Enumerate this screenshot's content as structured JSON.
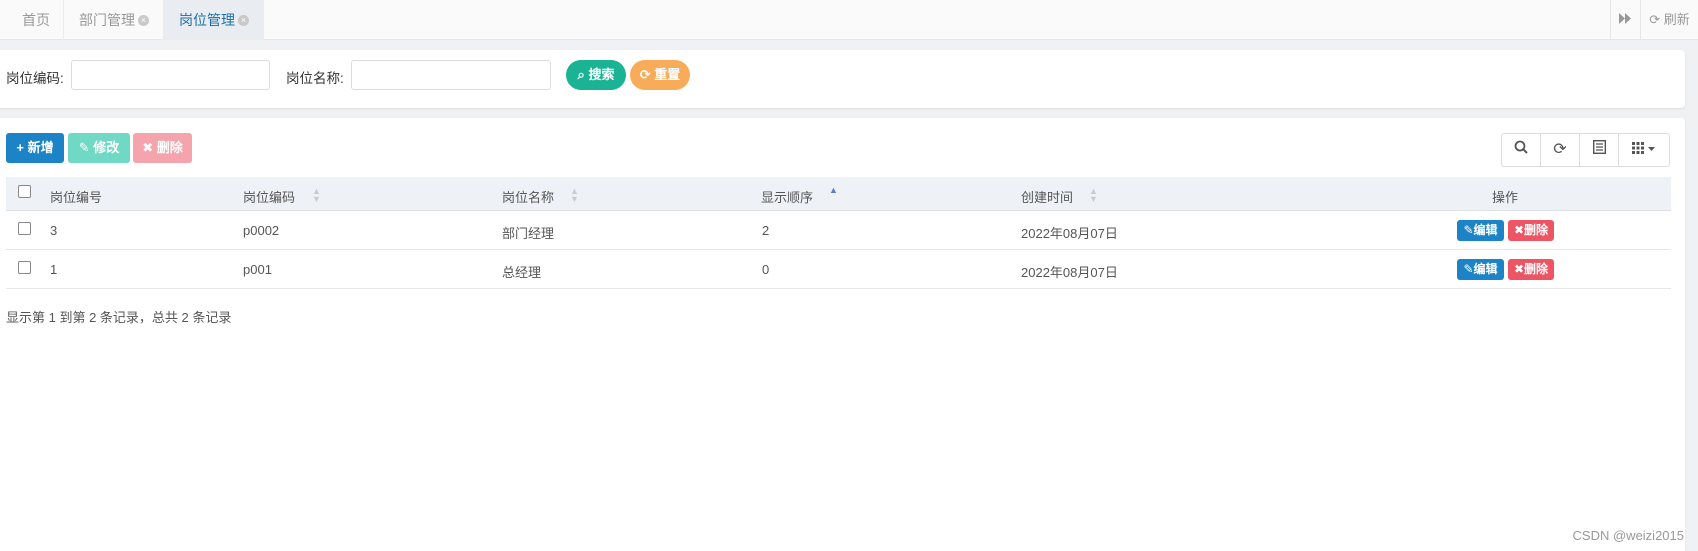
{
  "tabs": [
    {
      "label": "首页",
      "closable": false,
      "active": false
    },
    {
      "label": "部门管理",
      "closable": true,
      "active": false
    },
    {
      "label": "岗位管理",
      "closable": true,
      "active": true
    }
  ],
  "tabbar_right": {
    "forward_icon": "double-chevron-right-icon",
    "refresh_label": "刷新"
  },
  "search": {
    "post_code_label": "岗位编码:",
    "post_code_value": "",
    "post_name_label": "岗位名称:",
    "post_name_value": "",
    "search_button": "搜索",
    "reset_button": "重置"
  },
  "toolbar": {
    "add_label": "新增",
    "edit_label": "修改",
    "delete_label": "删除",
    "right_icons": [
      "search-icon",
      "refresh-icon",
      "toggle-view-icon",
      "columns-icon"
    ]
  },
  "table": {
    "columns": [
      "岗位编号",
      "岗位编码",
      "岗位名称",
      "显示顺序",
      "创建时间",
      "操作"
    ],
    "sorted_column": "显示顺序",
    "rows": [
      {
        "id": "3",
        "code": "p0002",
        "name": "部门经理",
        "order": "2",
        "created": "2022年08月07日",
        "edit": "编辑",
        "delete": "删除"
      },
      {
        "id": "1",
        "code": "p001",
        "name": "总经理",
        "order": "0",
        "created": "2022年08月07日",
        "edit": "编辑",
        "delete": "删除"
      }
    ]
  },
  "footer": {
    "summary": "显示第 1 到第 2 条记录，总共 2 条记录"
  },
  "watermark": "CSDN @weizi2015",
  "colors": {
    "primary": "#1c84c6",
    "success": "#1ab394",
    "warning": "#f8ac59",
    "danger": "#ed5565",
    "active_tab_text": "#1c6ea8"
  }
}
